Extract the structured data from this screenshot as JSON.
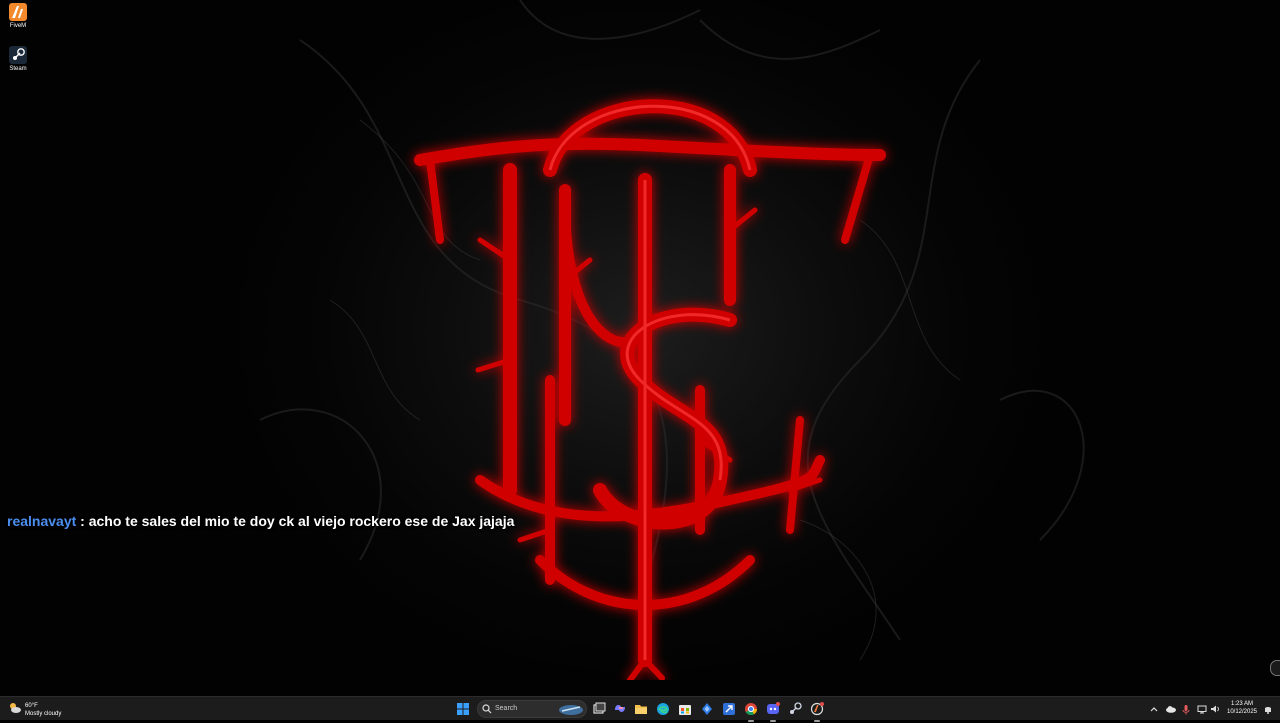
{
  "desktop": {
    "icons": [
      {
        "label": "FiveM",
        "icon": "fivem-icon"
      },
      {
        "label": "Steam",
        "icon": "steam-icon"
      }
    ],
    "wallpaper": {
      "logo": "red-gothic-monogram",
      "accent": "#d40000"
    }
  },
  "chat": {
    "username": "realnavayt",
    "separator": " : ",
    "message": "acho te sales del mio te doy ck al viejo rockero ese de Jax jajaja",
    "username_color": "#4b8ef0"
  },
  "taskbar": {
    "weather": {
      "temp": "60°F",
      "condition": "Mostly cloudy"
    },
    "search": {
      "placeholder": "Search"
    },
    "apps": [
      "windows-start-icon",
      "task-view-icon",
      "copilot-icon",
      "file-explorer-icon",
      "edge-icon",
      "store-icon",
      "app-icon",
      "app-icon-2",
      "chrome-icon",
      "discord-icon",
      "steam-icon",
      "fivem-icon"
    ],
    "clock": {
      "time": "1:23 AM",
      "date": "10/12/2025"
    }
  }
}
